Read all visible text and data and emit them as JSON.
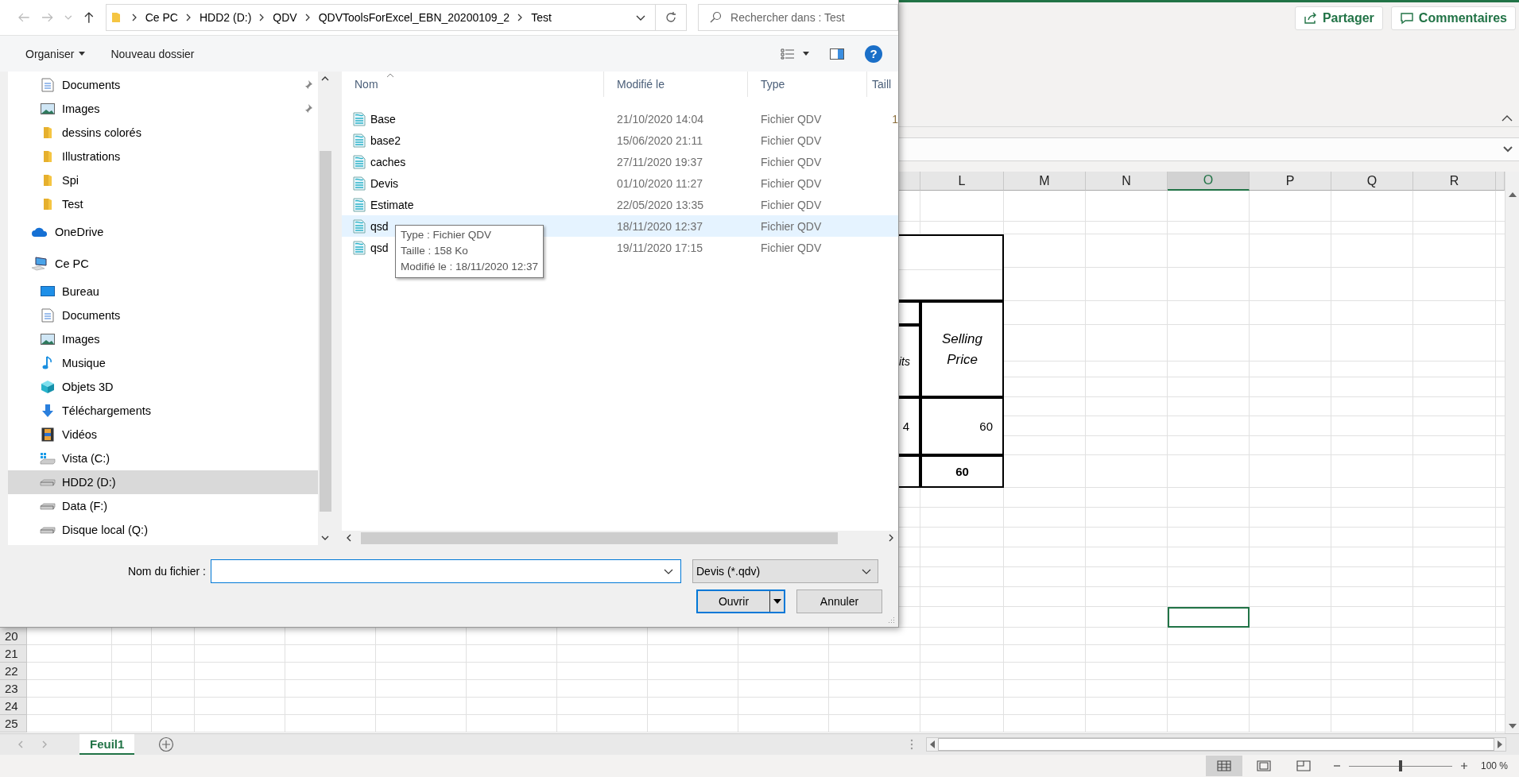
{
  "dialog": {
    "breadcrumb": [
      {
        "label": "Ce PC"
      },
      {
        "label": "HDD2 (D:)"
      },
      {
        "label": "QDV"
      },
      {
        "label": "QDVToolsForExcel_EBN_20200109_2"
      },
      {
        "label": "Test"
      }
    ],
    "search": {
      "placeholder": "Rechercher dans : Test"
    },
    "toolbar": {
      "organize": "Organiser",
      "new_folder": "Nouveau dossier",
      "help": "?"
    },
    "quick_access": [
      {
        "label": "Documents",
        "kind": "documents",
        "pinned": true,
        "selected": false
      },
      {
        "label": "Images",
        "kind": "images",
        "pinned": true,
        "selected": false
      },
      {
        "label": "dessins colorés",
        "kind": "folder",
        "pinned": false,
        "selected": false
      },
      {
        "label": "Illustrations",
        "kind": "folder",
        "pinned": false,
        "selected": false
      },
      {
        "label": "Spi",
        "kind": "folder",
        "pinned": false,
        "selected": false
      },
      {
        "label": "Test",
        "kind": "folder",
        "pinned": false,
        "selected": false
      }
    ],
    "locations": [
      {
        "label": "OneDrive",
        "kind": "onedrive",
        "selected": false
      },
      {
        "label": "Ce PC",
        "kind": "pc",
        "selected": false,
        "children": [
          {
            "label": "Bureau",
            "kind": "desktop",
            "selected": false
          },
          {
            "label": "Documents",
            "kind": "documents",
            "selected": false
          },
          {
            "label": "Images",
            "kind": "images",
            "selected": false
          },
          {
            "label": "Musique",
            "kind": "music",
            "selected": false
          },
          {
            "label": "Objets 3D",
            "kind": "objects3d",
            "selected": false
          },
          {
            "label": "Téléchargements",
            "kind": "downloads",
            "selected": false
          },
          {
            "label": "Vidéos",
            "kind": "videos",
            "selected": false
          },
          {
            "label": "Vista (C:)",
            "kind": "windows_drive",
            "selected": false
          },
          {
            "label": "HDD2 (D:)",
            "kind": "drive",
            "selected": true
          },
          {
            "label": "Data (F:)",
            "kind": "drive",
            "selected": false
          },
          {
            "label": "Disque local (Q:)",
            "kind": "drive",
            "selected": false
          }
        ]
      }
    ],
    "columns": [
      {
        "label": "Nom"
      },
      {
        "label": "Modifié le"
      },
      {
        "label": "Type"
      },
      {
        "label": "Taill"
      }
    ],
    "files": [
      {
        "name": "Base",
        "modified": "21/10/2020 14:04",
        "type": "Fichier QDV",
        "size": "1",
        "hovered": false
      },
      {
        "name": "base2",
        "modified": "15/06/2020 21:11",
        "type": "Fichier QDV",
        "hovered": false
      },
      {
        "name": "caches",
        "modified": "27/11/2020 19:37",
        "type": "Fichier QDV",
        "hovered": false
      },
      {
        "name": "Devis",
        "modified": "01/10/2020 11:27",
        "type": "Fichier QDV",
        "hovered": false
      },
      {
        "name": "Estimate",
        "modified": "22/05/2020 13:35",
        "type": "Fichier QDV",
        "hovered": false
      },
      {
        "name": "qsd",
        "modified": "18/11/2020 12:37",
        "type": "Fichier QDV",
        "hovered": true
      },
      {
        "name": "qsd",
        "modified": "19/11/2020 17:15",
        "type": "Fichier QDV",
        "hovered": false
      }
    ],
    "tooltip": {
      "lines": [
        "Type : Fichier QDV",
        "Taille : 158 Ko",
        "Modifié le : 18/11/2020 12:37"
      ]
    },
    "file_name": {
      "label": "Nom du fichier :"
    },
    "file_type": "Devis (*.qdv)",
    "buttons": {
      "open": "Ouvrir",
      "cancel": "Annuler"
    }
  },
  "excel": {
    "share": "Partager",
    "comments": "Commentaires",
    "sheet": {
      "columns": [
        {
          "label": "L",
          "selected": false
        },
        {
          "label": "M",
          "selected": false
        },
        {
          "label": "N",
          "selected": false
        },
        {
          "label": "O",
          "selected": true
        },
        {
          "label": "P",
          "selected": false
        },
        {
          "label": "Q",
          "selected": false
        },
        {
          "label": "R",
          "selected": false
        }
      ],
      "upper_rows": [
        {
          "selected": false
        },
        {
          "selected": false
        },
        {
          "selected": false
        },
        {
          "selected": false
        },
        {
          "selected": false
        },
        {
          "selected": false
        },
        {
          "selected": false
        },
        {
          "selected": false
        },
        {
          "selected": false
        },
        {
          "selected": false
        },
        {
          "selected": false
        },
        {
          "selected": false
        },
        {
          "selected": false
        },
        {
          "selected": false
        },
        {
          "selected": false
        },
        {
          "selected": false
        },
        {
          "selected": false
        },
        {
          "selected": false
        },
        {
          "selected": true
        }
      ],
      "row_labels": [
        {
          "label": "20"
        },
        {
          "label": "21"
        },
        {
          "label": "22"
        },
        {
          "label": "23"
        },
        {
          "label": "24"
        },
        {
          "label": "25"
        }
      ],
      "table": {
        "header_fragment": "its",
        "header": "Selling Price",
        "value_fragment": "4",
        "value": "60",
        "total": "60"
      }
    },
    "tabs": [
      {
        "label": "Feuil1",
        "selected": true
      }
    ],
    "zoom": {
      "level": 0.5,
      "reading": "100 %"
    }
  }
}
